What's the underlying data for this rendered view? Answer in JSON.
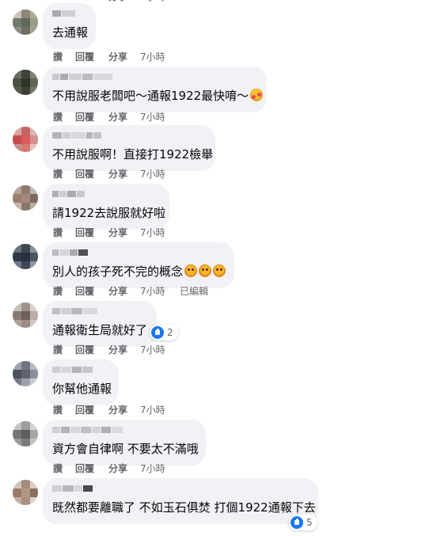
{
  "actions": {
    "like": "讚",
    "reply": "回覆",
    "share": "分享",
    "edited": "已編輯"
  },
  "icons": {
    "reaction": "like-icon",
    "emoji_love": "smiling-face-with-hearts-icon",
    "emoji_angry": "angry-face-icon"
  },
  "colors": {
    "bubble": "#f0f2f5",
    "meta_text": "#65676b",
    "like_blue": "#1877f2"
  },
  "comments": [
    {
      "text": "去通報",
      "time": "7小時"
    },
    {
      "text": "不用說服老闆吧～通報1922最快唷～",
      "time": "7小時",
      "emoji": "love"
    },
    {
      "text": "不用說服啊！直接打1922檢舉",
      "time": "7小時"
    },
    {
      "text": "請1922去說服就好啦",
      "time": "7小時"
    },
    {
      "text": "別人的孩子死不完的概念",
      "time": "7小時",
      "emoji": "angry-x3",
      "edited": true
    },
    {
      "text": "通報衛生局就好了",
      "time": "7小時",
      "reactions": "2"
    },
    {
      "text": "你幫他通報",
      "time": "7小時"
    },
    {
      "text": "資方會自律啊 不要太不滿哦",
      "time": "7小時"
    },
    {
      "text": "既然都要離職了 不如玉石俱焚 打個1922通報下去",
      "time": "7小時",
      "reactions": "5"
    }
  ]
}
